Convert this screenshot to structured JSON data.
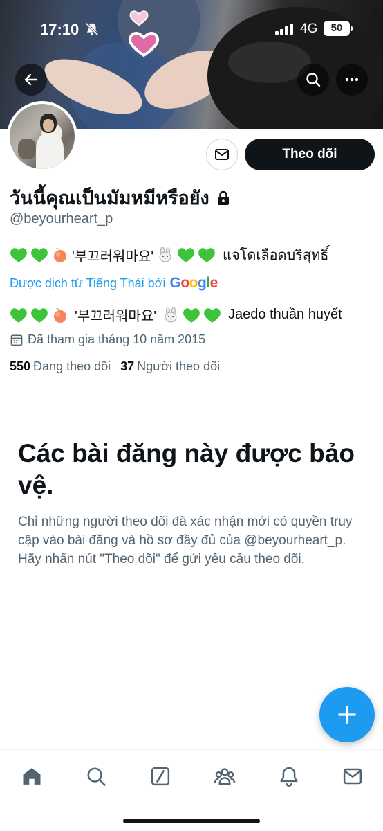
{
  "status_bar": {
    "time": "17:10",
    "network": "4G",
    "battery": "50"
  },
  "header": {
    "back_icon": "arrow-left-icon",
    "search_icon": "search-icon",
    "more_icon": "more-horizontal-icon"
  },
  "profile": {
    "display_name": "วันนี้คุณเป็นมัมหมีหรือยัง",
    "lock_icon": "lock-icon",
    "handle": "@beyourheart_p",
    "follow_label": "Theo dõi",
    "bio_original_text": "'부끄러워마요'",
    "bio_original_tail": "แจโดเลือดบริสุทธิ์",
    "translated_by": "Được dịch từ Tiếng Thái bởi",
    "translator": "Google",
    "bio_translated_text": "'부끄러워마요'",
    "bio_translated_tail": "Jaedo thuần huyết",
    "joined": "Đã tham gia tháng 10 năm 2015",
    "following_count": "550",
    "following_label": "Đang theo dõi",
    "followers_count": "37",
    "followers_label": "Người theo dõi"
  },
  "protected": {
    "title": "Các bài đăng này được bảo vệ.",
    "description": "Chỉ những người theo dõi đã xác nhận mới có quyền truy cập vào bài đăng và hồ sơ đầy đủ của @beyourheart_p. Hãy nhấn nút \"Theo dõi\" để gửi yêu cầu theo dõi."
  },
  "colors": {
    "accent": "#1d9bf0",
    "text_primary": "#0f1419",
    "text_secondary": "#536471",
    "heart_green": "#3ec43a"
  },
  "tabs": [
    "home-icon",
    "search-icon",
    "grok-icon",
    "communities-icon",
    "notifications-icon",
    "messages-icon"
  ]
}
